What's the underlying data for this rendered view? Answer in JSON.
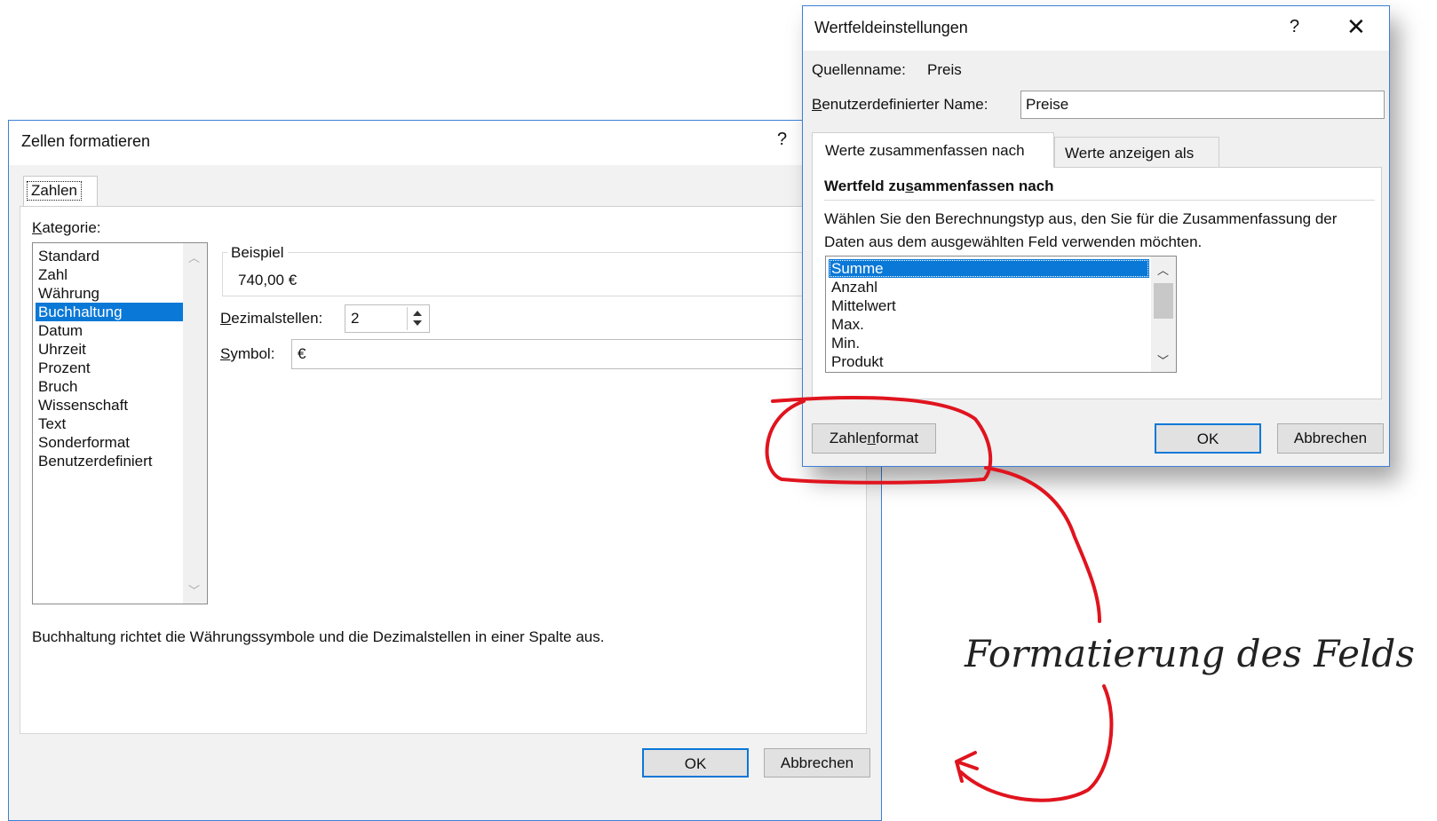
{
  "zellen_formatieren": {
    "title": "Zellen formatieren",
    "help": "?",
    "tab": "Zahlen",
    "kategorie_label": "Kategorie:",
    "kategorien": [
      "Standard",
      "Zahl",
      "Währung",
      "Buchhaltung",
      "Datum",
      "Uhrzeit",
      "Prozent",
      "Bruch",
      "Wissenschaft",
      "Text",
      "Sonderformat",
      "Benutzerdefiniert"
    ],
    "selected_kategorie": "Buchhaltung",
    "beispiel_label": "Beispiel",
    "beispiel_value": "740,00 €",
    "dezimalstellen_label": "Dezimalstellen:",
    "dezimalstellen_value": "2",
    "symbol_label": "Symbol:",
    "symbol_value": "€",
    "description": "Buchhaltung richtet die Währungssymbole und die Dezimalstellen in einer Spalte aus.",
    "ok": "OK",
    "cancel": "Abbrechen"
  },
  "wertfeld": {
    "title": "Wertfeldeinstellungen",
    "help": "?",
    "close": "✕",
    "quellenname_label": "Quellenname:",
    "quellenname_value": "Preis",
    "benutzername_label": "Benutzerdefinierter Name:",
    "benutzername_value": "Preise",
    "tab_active": "Werte zusammenfassen nach",
    "tab_inactive": "Werte anzeigen als",
    "section_heading": "Wertfeld zusammenfassen nach",
    "section_desc": "Wählen Sie den Berechnungstyp aus, den Sie für die Zusammenfassung der Daten aus dem ausgewählten Feld verwenden möchten.",
    "calc_types": [
      "Summe",
      "Anzahl",
      "Mittelwert",
      "Max.",
      "Min.",
      "Produkt"
    ],
    "selected_calc": "Summe",
    "zahlenformat_button": "Zahlenformat",
    "ok": "OK",
    "cancel": "Abbrechen"
  },
  "annotation": {
    "text": "Formatierung des Felds",
    "color": "#e0141e"
  }
}
